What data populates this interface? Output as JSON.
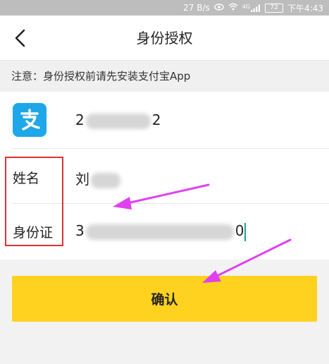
{
  "status_bar": {
    "speed": "27 B/s",
    "signal_label": "4G",
    "battery": "72",
    "time": "下午4:43"
  },
  "nav": {
    "title": "身份授权"
  },
  "notice": {
    "text": "注意：身份授权前请先安装支付宝App"
  },
  "form": {
    "alipay_account": {
      "prefix": "2",
      "suffix": "2"
    },
    "name": {
      "label": "姓名",
      "prefix": "刘"
    },
    "id_number": {
      "label": "身份证",
      "prefix": "3",
      "suffix": "0"
    }
  },
  "confirm_button": {
    "label": "确认"
  },
  "colors": {
    "accent_yellow": "#ffd21f",
    "alipay_blue": "#1ea7e9",
    "annotation_red": "#e03030",
    "annotation_magenta": "#e040f0",
    "caret_teal": "#1aa38c"
  },
  "icons": {
    "back": "chevron-left-icon",
    "alipay": "alipay-logo-icon",
    "eye": "eye-icon",
    "wifi": "wifi-icon",
    "signal": "signal-icon",
    "battery": "battery-icon"
  }
}
